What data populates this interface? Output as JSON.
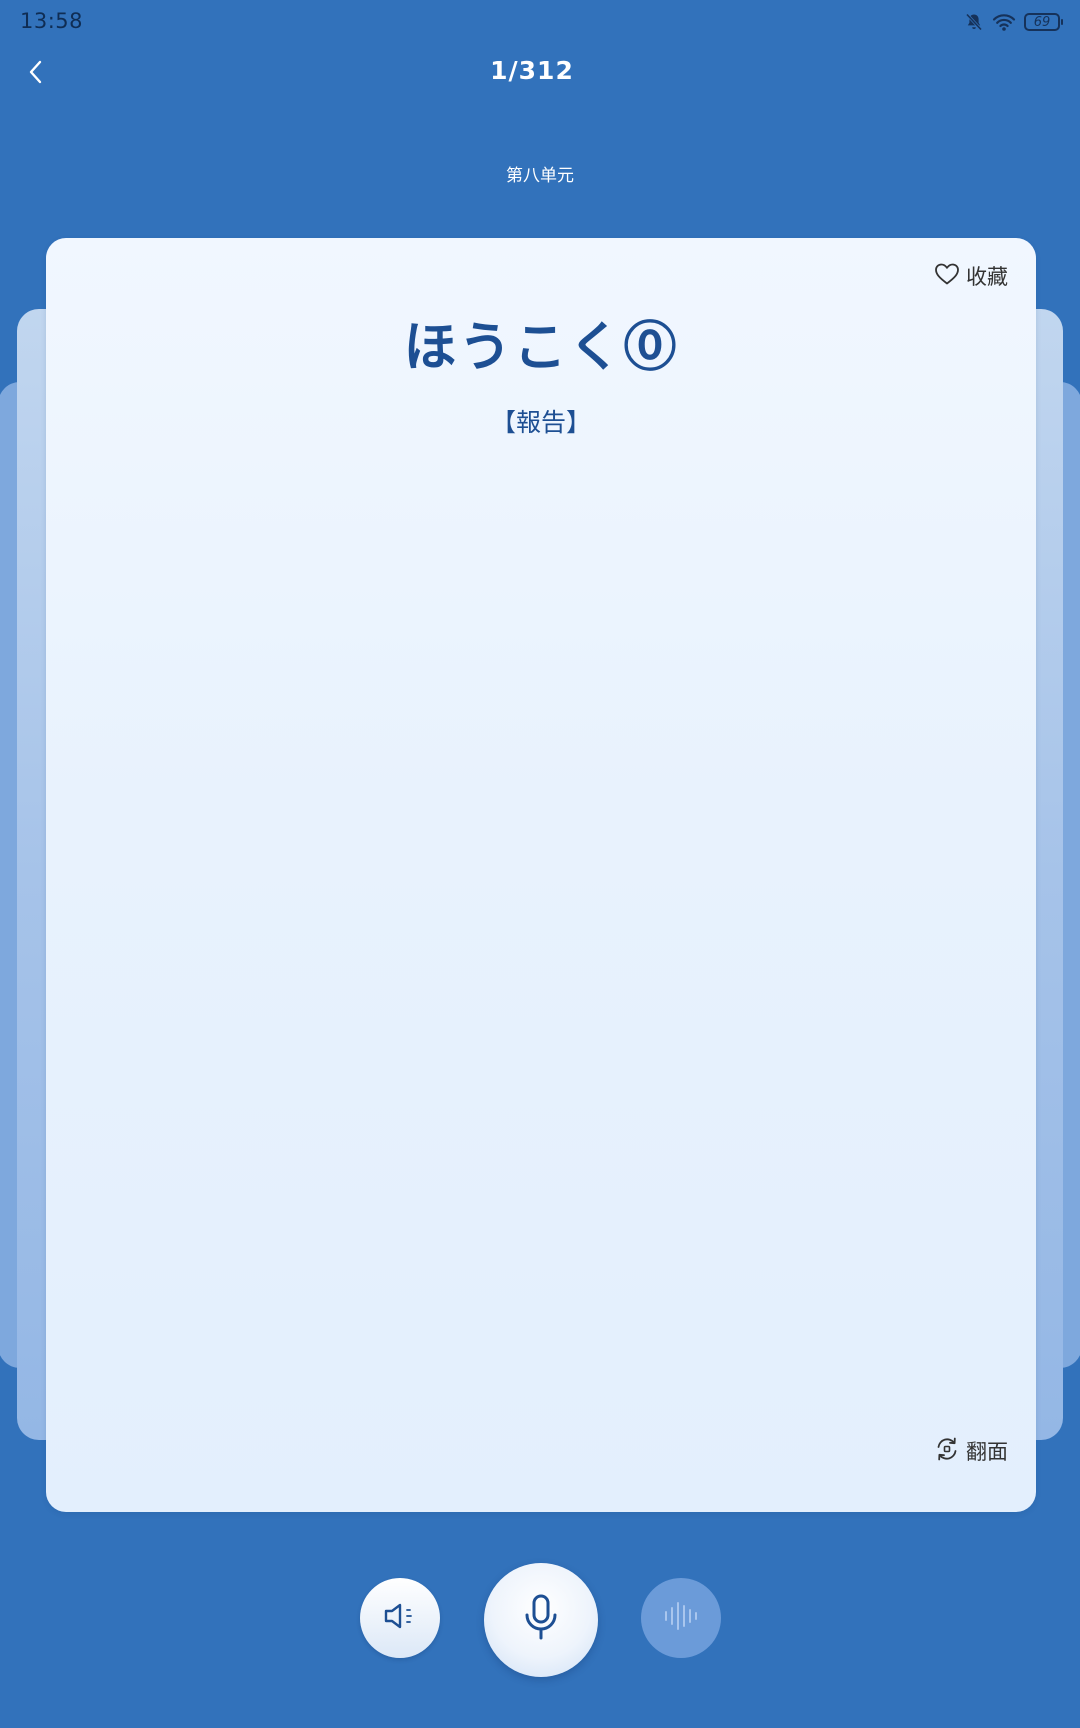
{
  "status_bar": {
    "time": "13:58",
    "battery": "69",
    "icons": [
      "bell-muted-icon",
      "wifi-icon",
      "battery-icon"
    ]
  },
  "header": {
    "counter": "1/312",
    "unit": "第八单元"
  },
  "card": {
    "favorite_label": "收藏",
    "kana": "ほうこく⓪",
    "kanji": "【報告】",
    "flip_label": "翻面"
  },
  "controls": {
    "icons": [
      "speaker-icon",
      "microphone-icon",
      "waveform-icon"
    ]
  },
  "colors": {
    "background": "#3272bb",
    "card": "#eaf3fe",
    "accent_text": "#1d4f93",
    "playback_disabled": "#6b9bd9"
  }
}
